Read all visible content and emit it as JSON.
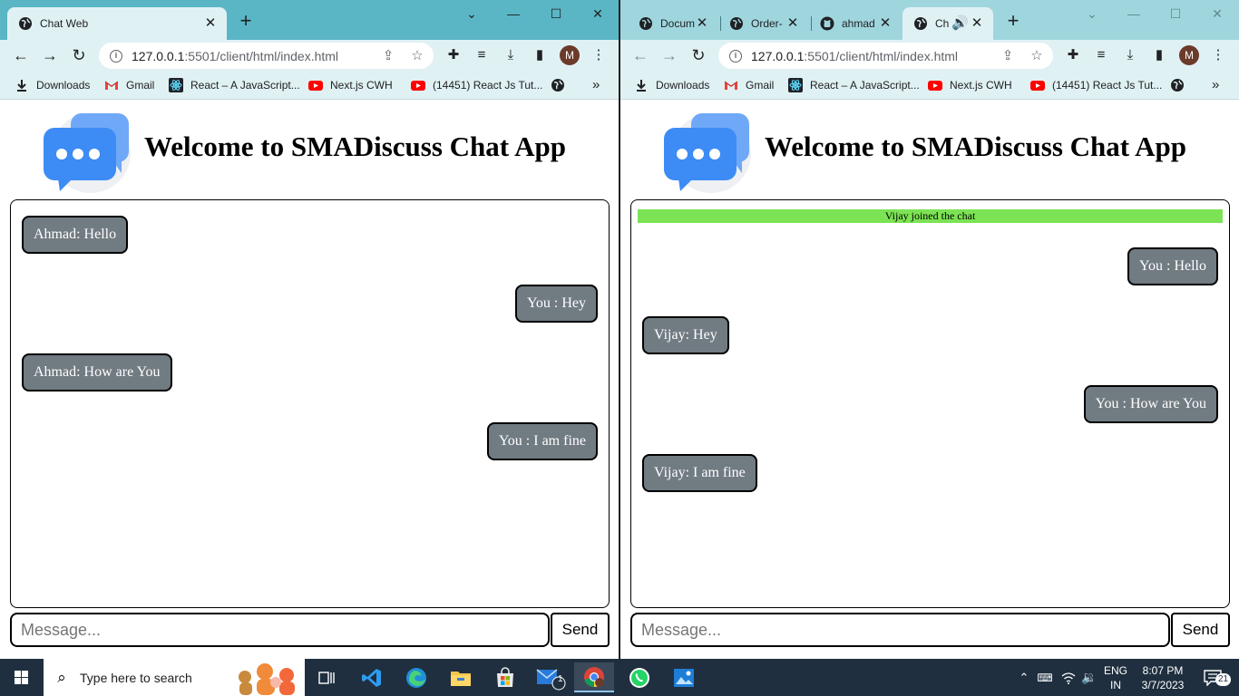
{
  "left_window": {
    "tabs": [
      {
        "title": "Chat Web",
        "active": true
      }
    ],
    "window_controls": {
      "minimize": "—",
      "maximize": "☐",
      "close": "✕",
      "dropdown": "⌄"
    },
    "address": {
      "host": "127.0.0.1",
      "path": ":5501/client/html/index.html"
    },
    "bookmarks": [
      {
        "label": "Downloads",
        "icon": "download-icon"
      },
      {
        "label": "Gmail",
        "icon": "gmail-icon"
      },
      {
        "label": "React – A JavaScript...",
        "icon": "react-icon"
      },
      {
        "label": "Next.js CWH",
        "icon": "youtube-icon"
      },
      {
        "label": "(14451) React Js Tut...",
        "icon": "youtube-icon"
      }
    ],
    "page": {
      "heading": "Welcome to SMADiscuss Chat App",
      "messages": [
        {
          "text": "Ahmad: Hello",
          "side": "in"
        },
        {
          "text": "You : Hey",
          "side": "out"
        },
        {
          "text": "Ahmad: How are You",
          "side": "in"
        },
        {
          "text": "You : I am fine",
          "side": "out"
        }
      ],
      "input_placeholder": "Message...",
      "send_label": "Send"
    }
  },
  "right_window": {
    "tabs": [
      {
        "title": "Docum",
        "active": false
      },
      {
        "title": "Order-",
        "active": false
      },
      {
        "title": "ahmad",
        "active": false
      },
      {
        "title": "Ch",
        "active": true
      }
    ],
    "address": {
      "host": "127.0.0.1",
      "path": ":5501/client/html/index.html"
    },
    "bookmarks": [
      {
        "label": "Downloads",
        "icon": "download-icon"
      },
      {
        "label": "Gmail",
        "icon": "gmail-icon"
      },
      {
        "label": "React – A JavaScript...",
        "icon": "react-icon"
      },
      {
        "label": "Next.js CWH",
        "icon": "youtube-icon"
      },
      {
        "label": "(14451) React Js Tut...",
        "icon": "youtube-icon"
      }
    ],
    "page": {
      "heading": "Welcome to SMADiscuss Chat App",
      "notice": "Vijay joined the chat",
      "messages": [
        {
          "text": "You : Hello",
          "side": "out"
        },
        {
          "text": "Vijay: Hey",
          "side": "in"
        },
        {
          "text": "You : How are You",
          "side": "out"
        },
        {
          "text": "Vijay: I am fine",
          "side": "in"
        }
      ],
      "input_placeholder": "Message...",
      "send_label": "Send"
    }
  },
  "avatar_letter": "M",
  "taskbar": {
    "search_placeholder": "Type here to search",
    "language": "ENG",
    "region": "IN",
    "time": "8:07 PM",
    "date": "3/7/2023",
    "notification_count": "21",
    "mail_badge": "1"
  },
  "colors": {
    "tabbar_left": "#5ab6c4",
    "tabbar_right": "#9fd6de",
    "toolbar": "#e0f1f4",
    "bubble": "#717b82",
    "notice": "#7ce354",
    "taskbar": "#1f2f3f"
  }
}
